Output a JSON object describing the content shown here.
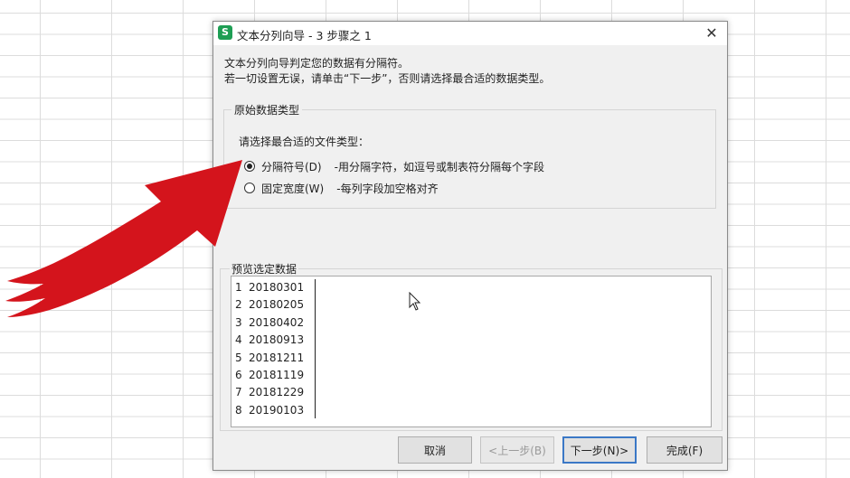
{
  "window": {
    "title": "文本分列向导 - 3 步骤之 1",
    "app_icon_letter": "S",
    "close_glyph": "✕"
  },
  "description": {
    "line1": "文本分列向导判定您的数据有分隔符。",
    "line2": "若一切设置无误，请单击“下一步”，否则请选择最合适的数据类型。"
  },
  "original_type": {
    "legend": "原始数据类型",
    "prompt": "请选择最合适的文件类型：",
    "options": [
      {
        "label": "分隔符号(D)",
        "description": "-用分隔字符，如逗号或制表符分隔每个字段",
        "selected": true
      },
      {
        "label": "固定宽度(W)",
        "description": "-每列字段加空格对齐",
        "selected": false
      }
    ]
  },
  "preview": {
    "legend": "预览选定数据",
    "rows": [
      {
        "num": "1",
        "value": "20180301"
      },
      {
        "num": "2",
        "value": "20180205"
      },
      {
        "num": "3",
        "value": "20180402"
      },
      {
        "num": "4",
        "value": "20180913"
      },
      {
        "num": "5",
        "value": "20181211"
      },
      {
        "num": "6",
        "value": "20181119"
      },
      {
        "num": "7",
        "value": "20181229"
      },
      {
        "num": "8",
        "value": "20190103"
      }
    ]
  },
  "buttons": {
    "cancel": "取消",
    "prev": "<上一步(B)",
    "next": "下一步(N)>",
    "finish": "完成(F)"
  },
  "colors": {
    "arrow": "#d4141c",
    "app_icon": "#1e9e54",
    "default_button_border": "#3b78c6"
  }
}
